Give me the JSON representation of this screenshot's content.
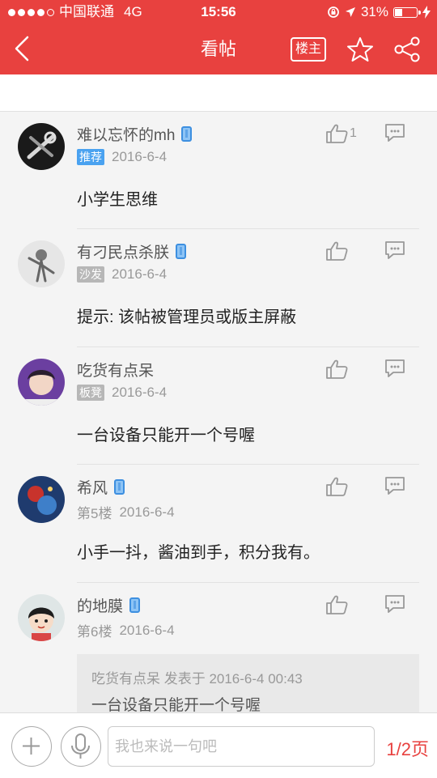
{
  "status_bar": {
    "carrier": "中国联通",
    "network": "4G",
    "time": "15:56",
    "battery": "31%",
    "battery_level": 0.31
  },
  "nav": {
    "title": "看帖",
    "owner_only_label": "楼主",
    "icons": [
      "back-arrow-icon",
      "star-icon",
      "share-icon"
    ]
  },
  "posts": [
    {
      "username": "难以忘怀的mh",
      "tag": "推荐",
      "date": "2016-6-4",
      "likes": "1",
      "content": "小学生思维",
      "mobile": true
    },
    {
      "username": "有刁民点杀朕",
      "tag": "沙发",
      "date": "2016-6-4",
      "likes": "",
      "content": "提示: 该帖被管理员或版主屏蔽",
      "mobile": true
    },
    {
      "username": "吃货有点呆",
      "tag": "板凳",
      "date": "2016-6-4",
      "likes": "",
      "content": "一台设备只能开一个号喔",
      "mobile": false
    },
    {
      "username": "希风",
      "floor": "第5楼",
      "date": "2016-6-4",
      "likes": "",
      "content": "小手一抖，酱油到手，积分我有。",
      "mobile": true
    },
    {
      "username": "的地膜",
      "floor": "第6楼",
      "date": "2016-6-4",
      "likes": "",
      "mobile": true,
      "quote": {
        "header": "吃货有点呆 发表于 2016-6-4 00:43",
        "text": "一台设备只能开一个号喔"
      }
    }
  ],
  "bottom": {
    "placeholder": "我也来说一句吧",
    "pager": "1/2页"
  },
  "colors": {
    "accent": "#e8413f",
    "tag_blue": "#4aa2f0",
    "tag_gray": "#b7b7b7"
  }
}
